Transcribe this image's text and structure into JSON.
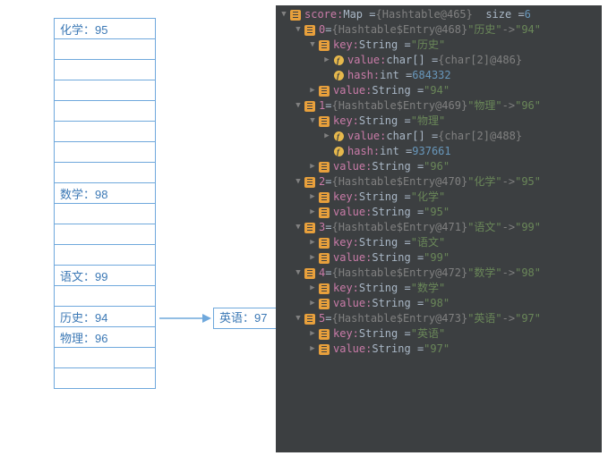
{
  "buckets": {
    "cells": [
      {
        "label": "化学",
        "value": "95"
      },
      {
        "label": "",
        "value": ""
      },
      {
        "label": "",
        "value": ""
      },
      {
        "label": "",
        "value": ""
      },
      {
        "label": "",
        "value": ""
      },
      {
        "label": "",
        "value": ""
      },
      {
        "label": "",
        "value": ""
      },
      {
        "label": "",
        "value": ""
      },
      {
        "label": "数学",
        "value": "98"
      },
      {
        "label": "",
        "value": ""
      },
      {
        "label": "",
        "value": ""
      },
      {
        "label": "",
        "value": ""
      },
      {
        "label": "语文",
        "value": "99"
      },
      {
        "label": "",
        "value": ""
      },
      {
        "label": "历史",
        "value": "94"
      },
      {
        "label": "物理",
        "value": "96"
      },
      {
        "label": "",
        "value": ""
      },
      {
        "label": "",
        "value": ""
      }
    ],
    "ext": {
      "label": "英语",
      "value": "97"
    }
  },
  "tree": {
    "root": {
      "name": "score",
      "type": "Map",
      "ref": "{Hashtable@465}",
      "sizeLabel": "size",
      "size": "6"
    },
    "entries": [
      {
        "idx": "0",
        "ref": "{Hashtable$Entry@468}",
        "k": "历史",
        "v": "94",
        "keyExpanded": true,
        "charRef": "{char[2]@486}",
        "hash": "684332"
      },
      {
        "idx": "1",
        "ref": "{Hashtable$Entry@469}",
        "k": "物理",
        "v": "96",
        "keyExpanded": true,
        "charRef": "{char[2]@488}",
        "hash": "937661"
      },
      {
        "idx": "2",
        "ref": "{Hashtable$Entry@470}",
        "k": "化学",
        "v": "95",
        "keyExpanded": false
      },
      {
        "idx": "3",
        "ref": "{Hashtable$Entry@471}",
        "k": "语文",
        "v": "99",
        "keyExpanded": false
      },
      {
        "idx": "4",
        "ref": "{Hashtable$Entry@472}",
        "k": "数学",
        "v": "98",
        "keyExpanded": false
      },
      {
        "idx": "5",
        "ref": "{Hashtable$Entry@473}",
        "k": "英语",
        "v": "97",
        "keyExpanded": false
      }
    ],
    "labels": {
      "key": "key",
      "value": "value",
      "string": "String",
      "charArr": "char[]",
      "hash": "hash",
      "int": "int"
    }
  }
}
